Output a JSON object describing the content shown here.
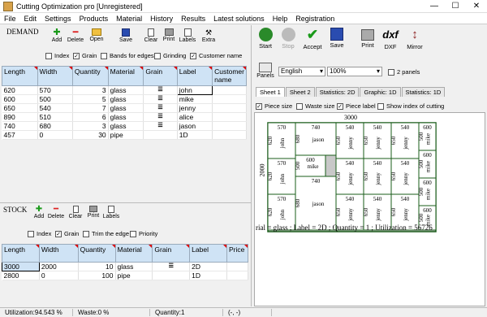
{
  "window": {
    "title": "Cutting Optimization pro [Unregistered]",
    "minimize": "—",
    "maximize": "☐",
    "close": "✕"
  },
  "menu": [
    "File",
    "Edit",
    "Settings",
    "Products",
    "Material",
    "History",
    "Results",
    "Latest solutions",
    "Help",
    "Registration"
  ],
  "demand": {
    "heading": "DEMAND",
    "toolbar": {
      "add": "Add",
      "delete": "Delete",
      "open": "Open",
      "save": "Save",
      "clear": "Clear",
      "print": "Print",
      "labels": "Labels",
      "extra": "Extra"
    },
    "options": {
      "index": "Index",
      "grain": "Grain",
      "bands": "Bands for edges",
      "grinding": "Grinding",
      "customer": "Customer name"
    },
    "columns": [
      "Length",
      "Width",
      "Quantity",
      "Material",
      "Grain",
      "Label",
      "Customer name"
    ],
    "rows": [
      {
        "length": "620",
        "width": "570",
        "quantity": "3",
        "material": "glass",
        "label": "john"
      },
      {
        "length": "600",
        "width": "500",
        "quantity": "5",
        "material": "glass",
        "label": "mike"
      },
      {
        "length": "650",
        "width": "540",
        "quantity": "7",
        "material": "glass",
        "label": "jenny"
      },
      {
        "length": "890",
        "width": "510",
        "quantity": "6",
        "material": "glass",
        "label": "alice"
      },
      {
        "length": "740",
        "width": "680",
        "quantity": "3",
        "material": "glass",
        "label": "jason"
      },
      {
        "length": "457",
        "width": "0",
        "quantity": "30",
        "material": "pipe",
        "label": "1D"
      }
    ]
  },
  "stock": {
    "heading": "STOCK",
    "toolbar": {
      "add": "Add",
      "delete": "Delete",
      "clear": "Clear",
      "print": "Print",
      "labels": "Labels"
    },
    "options": {
      "index": "Index",
      "grain": "Grain",
      "trim": "Trim the edge",
      "priority": "Priority"
    },
    "columns": [
      "Length",
      "Width",
      "Quantity",
      "Material",
      "Grain",
      "Label",
      "Price"
    ],
    "rows": [
      {
        "length": "3000",
        "width": "2000",
        "quantity": "10",
        "material": "glass",
        "label": "2D"
      },
      {
        "length": "2800",
        "width": "0",
        "quantity": "100",
        "material": "pipe",
        "label": "1D"
      }
    ]
  },
  "results": {
    "toolbar": {
      "start": "Start",
      "stop": "Stop",
      "accept": "Accept",
      "save": "Save",
      "print": "Print",
      "dxf": "DXF",
      "mirror": "Mirror",
      "dxf_glyph": "dxf",
      "panels": "Panels"
    },
    "language": "English",
    "zoom": "100%",
    "two_panels": "2 panels",
    "tabs": [
      "Sheet 1",
      "Sheet 2",
      "Statistics: 2D",
      "Graphic: 1D",
      "Statistics: 1D"
    ],
    "options": {
      "piece_size": "Piece size",
      "waste_size": "Waste size",
      "piece_label": "Piece label",
      "show_index": "Show index of cutting"
    },
    "sheet_width_label": "3000",
    "sheet_height_label": "2000",
    "caption": "rial = glass ; Label = 2D ; Quantity = 1 ; Utilization = 56726",
    "pieces": [
      {
        "w": "570",
        "h": "620",
        "label": "john"
      },
      {
        "w": "740",
        "h": "680",
        "label": "jason"
      },
      {
        "w": "540",
        "h": "650",
        "label": "jenny"
      },
      {
        "w": "540",
        "h": "650",
        "label": "jenny"
      },
      {
        "w": "540",
        "h": "650",
        "label": "jenny"
      },
      {
        "w": "600",
        "h": "500",
        "label": "mike"
      },
      {
        "w": "570",
        "h": "620",
        "label": "john"
      },
      {
        "w": "600",
        "h": "500",
        "label": "mike"
      },
      {
        "w": "540",
        "h": "650",
        "label": "jenny"
      },
      {
        "w": "540",
        "h": "650",
        "label": "jenny"
      },
      {
        "w": "540",
        "h": "650",
        "label": "jenny"
      },
      {
        "w": "600",
        "h": "500",
        "label": "mike"
      },
      {
        "w": "570",
        "h": "620",
        "label": "john"
      },
      {
        "w": "740",
        "h": "680",
        "label": "jason"
      },
      {
        "w": "540",
        "h": "650",
        "label": "jenny"
      },
      {
        "w": "540",
        "h": "650",
        "label": "jenny"
      },
      {
        "w": "540",
        "h": "650",
        "label": "jenny"
      },
      {
        "w": "600",
        "h": "500",
        "label": "mike"
      },
      {
        "w": "600",
        "h": "500",
        "label": "mike"
      }
    ]
  },
  "status": {
    "utilization": "Utilization:94.543 %",
    "waste": "Waste:0 %",
    "quantity": "Quantity:1",
    "coords": "(-, -)"
  },
  "colors": {
    "header_bg": "#cfe3f5",
    "piece_border": "#1a5c1a",
    "waste": "#c8c8c8"
  }
}
